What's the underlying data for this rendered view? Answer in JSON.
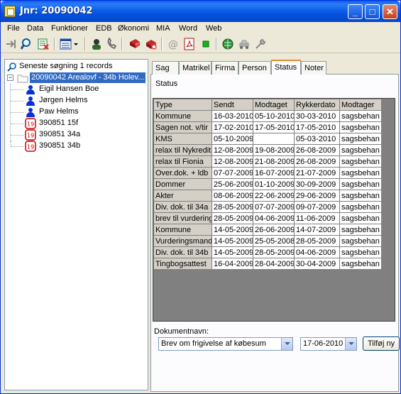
{
  "window": {
    "title": "Jnr: 20090042"
  },
  "menu": [
    "File",
    "Data",
    "Funktioner",
    "EDB",
    "Økonomi",
    "MIA",
    "Word",
    "Web"
  ],
  "toolbar": {
    "icons": [
      "import-icon",
      "search-icon",
      "excel-close-icon",
      "list-view-icon",
      "dropdown-icon",
      "person-icon",
      "phone-icon",
      "book-icon",
      "case-icon",
      "email-icon",
      "pdf-icon",
      "green-square-icon",
      "globe-icon",
      "car-icon",
      "tools-icon"
    ]
  },
  "tree": {
    "search_label": "Seneste søgning 1 records",
    "case_label": "20090042 Arealovf - 34b Holev...",
    "persons": [
      "Eigil Hansen Boe",
      "Jørgen Helms",
      "Paw Helms"
    ],
    "properties": [
      "390851 15f",
      "390851 34a",
      "390851 34b"
    ]
  },
  "tabs": [
    "Sag",
    "Matrikel",
    "Firma",
    "Person",
    "Status",
    "Noter"
  ],
  "active_tab": "Status",
  "status": {
    "section_label": "Status",
    "columns": [
      "Type",
      "Sendt",
      "Modtaget",
      "Rykkerdato",
      "Modtager"
    ],
    "rows": [
      [
        "Kommune",
        "16-03-2010",
        "05-10-2010",
        "30-03-2010",
        "sagsbehan"
      ],
      [
        "Sagen not. v/tir",
        "17-02-2010",
        "17-05-2010",
        "17-05-2010",
        "sagsbehan"
      ],
      [
        "KMS",
        "05-10-2009",
        "",
        "05-03-2010",
        "sagsbehan"
      ],
      [
        "relax til Nykredit",
        "12-08-2009",
        "19-08-2009",
        "26-08-2009",
        "sagsbehan"
      ],
      [
        "relax til Fionia",
        "12-08-2009",
        "21-08-2009",
        "26-08-2009",
        "sagsbehan"
      ],
      [
        "Over.dok. + ldb",
        "07-07-2009",
        "16-07-2009",
        "21-07-2009",
        "sagsbehan"
      ],
      [
        "Dommer",
        "25-06-2009",
        "01-10-2009",
        "30-09-2009",
        "sagsbehan"
      ],
      [
        "Akter",
        "08-06-2009",
        "22-06-2009",
        "29-06-2009",
        "sagsbehan"
      ],
      [
        "Div. dok. til 34a",
        "28-05-2009",
        "07-07-2009",
        "09-07-2009",
        "sagsbehan"
      ],
      [
        "brev til vurdering",
        "28-05-2009",
        "04-06-2009",
        "11-06-2009",
        "sagsbehan"
      ],
      [
        "Kommune",
        "14-05-2009",
        "26-06-2009",
        "14-07-2009",
        "sagsbehan"
      ],
      [
        "Vurderingsmand",
        "14-05-2009",
        "25-05-2008",
        "28-05-2009",
        "sagsbehan"
      ],
      [
        "Div. dok. til 34b",
        "14-05-2009",
        "28-05-2009",
        "04-06-2009",
        "sagsbehan"
      ],
      [
        "Tingbogsattest",
        "16-04-2009",
        "28-04-2009",
        "30-04-2009",
        "sagsbehan"
      ]
    ]
  },
  "document": {
    "label": "Dokumentnavn:",
    "selected": "Brev om frigivelse af købesum",
    "date": "17-06-2010",
    "add_label": "Tilføj ny"
  },
  "colors": {
    "titlebar": "#0553e0",
    "selection": "#316ac5",
    "active_tab_accent": "#e68b2c"
  }
}
